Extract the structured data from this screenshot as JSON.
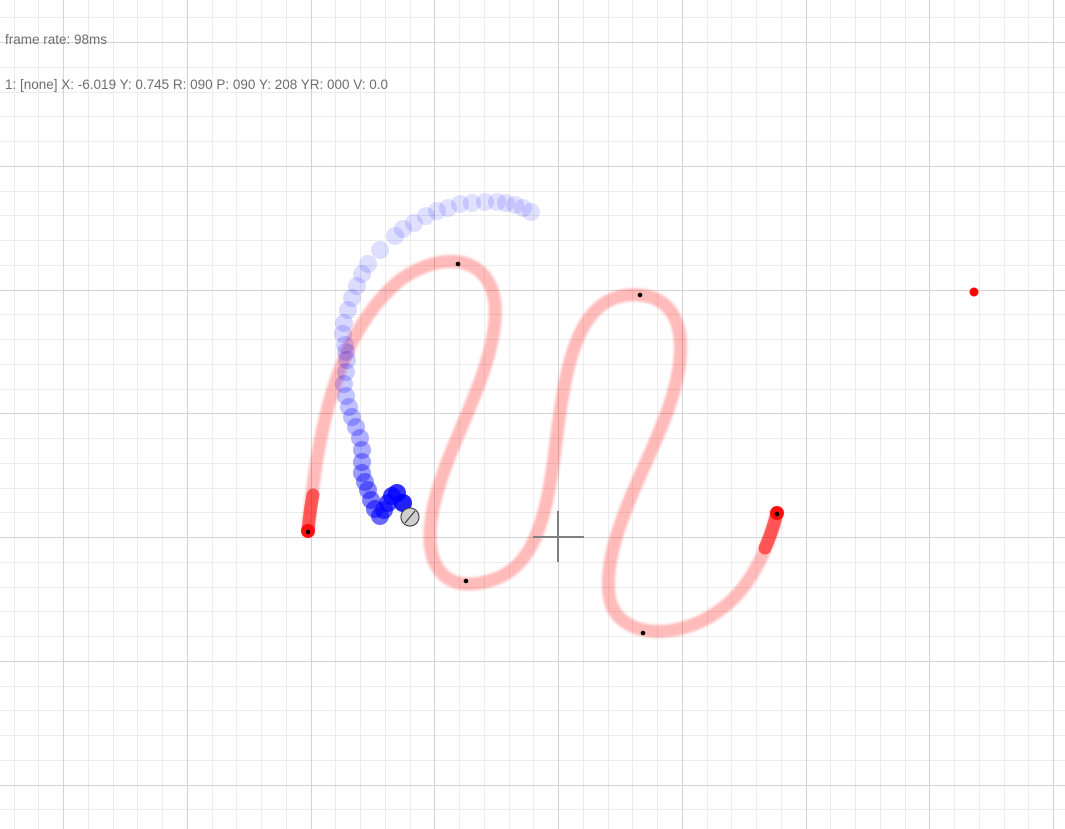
{
  "hud": {
    "frame_rate": "frame rate: 98ms",
    "status": "1: [none] X: -6.019 Y: 0.745 R: 090 P: 090 Y: 208 YR: 000 V: 0.0"
  },
  "colors": {
    "minor_grid": "#ececec",
    "major_grid": "#d3d3d3",
    "path": "#ff0000",
    "trail": "#0000ff",
    "crosshair": "#808080",
    "target": "#ff0000",
    "cursor_fill": "#cfcfcf"
  },
  "icons": {
    "crosshair": "crosshair-icon",
    "target": "target-dot-icon",
    "cursor": "pointer-handle-icon"
  }
}
